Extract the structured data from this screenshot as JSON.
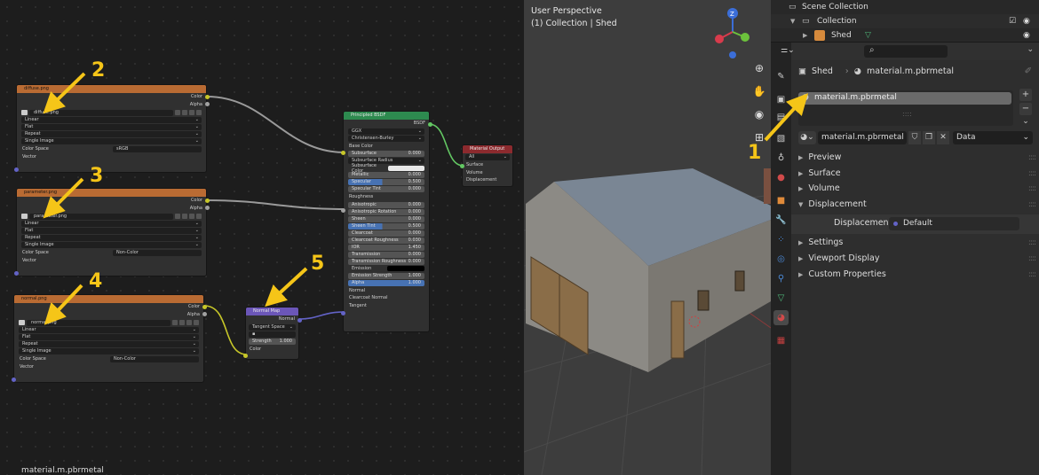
{
  "node_editor": {
    "footer_material": "material.m.pbrmetal",
    "annotations": [
      "2",
      "3",
      "4",
      "5",
      "1"
    ],
    "nodes": {
      "diffuse": {
        "title": "diffuse.png",
        "out_color": "Color",
        "out_alpha": "Alpha",
        "file": "diffuse.png",
        "interp": "Linear",
        "proj": "Flat",
        "ext": "Repeat",
        "source": "Single Image",
        "cs_label": "Color Space",
        "cs_value": "sRGB",
        "vector": "Vector"
      },
      "parameter": {
        "title": "parameter.png",
        "out_color": "Color",
        "out_alpha": "Alpha",
        "file": "parameter.png",
        "interp": "Linear",
        "proj": "Flat",
        "ext": "Repeat",
        "source": "Single Image",
        "cs_label": "Color Space",
        "cs_value": "Non-Color",
        "vector": "Vector"
      },
      "normal": {
        "title": "normal.png",
        "out_color": "Color",
        "out_alpha": "Alpha",
        "file": "normal.png",
        "interp": "Linear",
        "proj": "Flat",
        "ext": "Repeat",
        "source": "Single Image",
        "cs_label": "Color Space",
        "cs_value": "Non-Color",
        "vector": "Vector"
      },
      "normalmap": {
        "title": "Normal Map",
        "out": "Normal",
        "space": "Tangent Space",
        "strength_label": "Strength",
        "strength": "1.000",
        "in_color": "Color"
      },
      "bsdf": {
        "title": "Principled BSDF",
        "out": "BSDF",
        "dist": "GGX",
        "sss": "Christensen-Burley",
        "base_color": "Base Color",
        "fields": [
          {
            "l": "Subsurface",
            "v": "0.000"
          },
          {
            "l": "Subsurface Radius",
            "v": ""
          },
          {
            "l": "Subsurface Color",
            "v": ""
          },
          {
            "l": "Metallic",
            "v": "0.000"
          },
          {
            "l": "Specular",
            "v": "0.500"
          },
          {
            "l": "Specular Tint",
            "v": "0.000"
          },
          {
            "l": "Roughness",
            "v": ""
          },
          {
            "l": "Anisotropic",
            "v": "0.000"
          },
          {
            "l": "Anisotropic Rotation",
            "v": "0.000"
          },
          {
            "l": "Sheen",
            "v": "0.000"
          },
          {
            "l": "Sheen Tint",
            "v": "0.500"
          },
          {
            "l": "Clearcoat",
            "v": "0.000"
          },
          {
            "l": "Clearcoat Roughness",
            "v": "0.030"
          },
          {
            "l": "IOR",
            "v": "1.450"
          },
          {
            "l": "Transmission",
            "v": "0.000"
          },
          {
            "l": "Transmission Roughness",
            "v": "0.000"
          },
          {
            "l": "Emission",
            "v": ""
          },
          {
            "l": "Emission Strength",
            "v": "1.000"
          },
          {
            "l": "Alpha",
            "v": "1.000"
          },
          {
            "l": "Normal",
            "v": ""
          },
          {
            "l": "Clearcoat Normal",
            "v": ""
          },
          {
            "l": "Tangent",
            "v": ""
          }
        ]
      },
      "output": {
        "title": "Material Output",
        "target": "All",
        "surface": "Surface",
        "volume": "Volume",
        "displacement": "Displacement"
      }
    }
  },
  "viewport": {
    "title": "User Perspective",
    "subtitle": "(1) Collection | Shed"
  },
  "outliner": {
    "scene": "Scene Collection",
    "collection": "Collection",
    "object": "Shed"
  },
  "properties": {
    "object": "Shed",
    "material": "material.m.pbrmetal",
    "slot": "material.m.pbrmetal",
    "mat_field": "material.m.pbrmetal",
    "link": "Data",
    "panels": {
      "preview": "Preview",
      "surface": "Surface",
      "volume": "Volume",
      "displacement": "Displacement",
      "settings": "Settings",
      "viewport_display": "Viewport Display",
      "custom_props": "Custom Properties"
    },
    "disp_label": "Displacement",
    "disp_value": "Default"
  },
  "colors": {
    "accent": "#f5c518",
    "orange_header": "#b96b33",
    "green_header": "#2d8a4f",
    "red_header": "#8c2a2e",
    "purple_header": "#6b56b8",
    "selection": "#4772b3"
  }
}
